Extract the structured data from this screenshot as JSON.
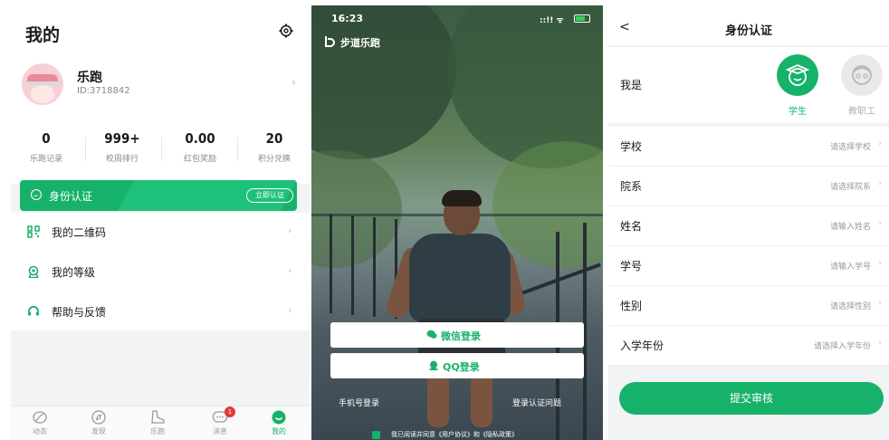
{
  "colors": {
    "accent": "#17b26a",
    "badge": "#e53935",
    "text": "#1a1a1a",
    "muted": "#888888"
  },
  "profile": {
    "page_title": "我的",
    "settings_icon": "gear-icon",
    "user_name": "乐跑",
    "user_id": "ID:3718842",
    "stats": [
      {
        "value": "0",
        "label": "乐跑记录"
      },
      {
        "value": "999+",
        "label": "校周排行"
      },
      {
        "value": "0.00",
        "label": "红包奖励"
      },
      {
        "value": "20",
        "label": "积分兑换"
      }
    ],
    "id_banner": {
      "label": "身份认证",
      "button": "立即认证"
    },
    "menu": [
      {
        "label": "我的二维码",
        "icon": "qr-code-icon"
      },
      {
        "label": "我的等级",
        "icon": "medal-icon"
      },
      {
        "label": "帮助与反馈",
        "icon": "help-icon"
      }
    ],
    "tabs": [
      {
        "label": "动态",
        "icon": "moments-icon",
        "active": false
      },
      {
        "label": "发现",
        "icon": "compass-icon",
        "active": false
      },
      {
        "label": "乐跑",
        "icon": "shoe-icon",
        "active": false
      },
      {
        "label": "消息",
        "icon": "message-icon",
        "active": false,
        "badge": "1"
      },
      {
        "label": "我的",
        "icon": "profile-icon",
        "active": true
      }
    ]
  },
  "login": {
    "time": "16:23",
    "status_icons": "::!! ᯤ",
    "app_name": "步道乐跑",
    "wechat_button": "微信登录",
    "qq_button": "QQ登录",
    "phone_login": "手机号登录",
    "login_issue": "登录认证问题",
    "agreement": "我已阅读并同意《用户协议》和《隐私政策》"
  },
  "verify": {
    "back_icon": "<",
    "title": "身份认证",
    "who_label": "我是",
    "roles": [
      {
        "label": "学生",
        "selected": true
      },
      {
        "label": "教职工",
        "selected": false
      }
    ],
    "fields": [
      {
        "label": "学校",
        "value": "请选择学校"
      },
      {
        "label": "院系",
        "value": "请选择院系"
      },
      {
        "label": "姓名",
        "value": "请输入姓名"
      },
      {
        "label": "学号",
        "value": "请输入学号"
      },
      {
        "label": "性别",
        "value": "请选择性别"
      },
      {
        "label": "入学年份",
        "value": "请选择入学年份"
      }
    ],
    "submit": "提交审核"
  }
}
